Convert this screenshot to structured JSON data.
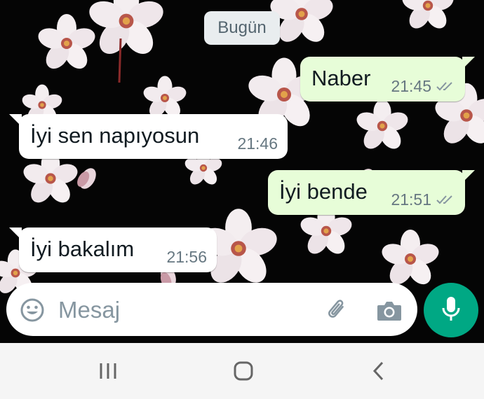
{
  "chat": {
    "date_divider": "Bugün",
    "messages": [
      {
        "direction": "outgoing",
        "text": "Naber",
        "time": "21:45",
        "status": "read-double-check"
      },
      {
        "direction": "incoming",
        "text": "İyi sen napıyosun",
        "time": "21:46"
      },
      {
        "direction": "outgoing",
        "text": "İyi bende",
        "time": "21:51",
        "status": "read-double-check"
      },
      {
        "direction": "incoming",
        "text": "İyi bakalım",
        "time": "21:56"
      }
    ]
  },
  "composer": {
    "placeholder": "Mesaj",
    "icons": [
      "emoji-icon",
      "attach-icon",
      "camera-icon",
      "mic-icon"
    ]
  },
  "nav_bar": {
    "buttons": [
      "recent-apps-icon",
      "home-icon",
      "back-icon"
    ]
  },
  "colors": {
    "outgoing_bubble": "#e7fdd8",
    "incoming_bubble": "#ffffff",
    "accent": "#00a884",
    "background": "#050505"
  }
}
